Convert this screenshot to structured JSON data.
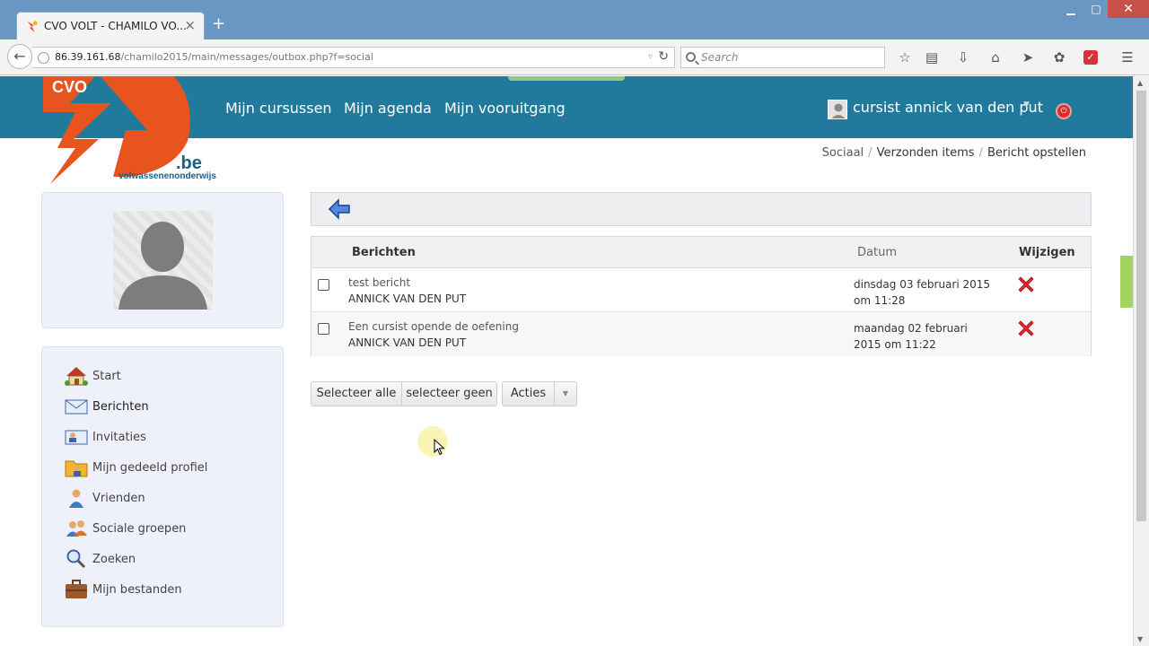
{
  "browser": {
    "tab_title": "CVO VOLT - CHAMILO VO...",
    "tab_close": "×",
    "new_tab": "+",
    "window_minimize": "▁",
    "window_maximize": "□",
    "window_close": "✕",
    "url_host": "86.39.161.68",
    "url_path": "/chamilo2015/main/messages/outbox.php?f=social",
    "search_placeholder": "Search",
    "toolbar_icons": [
      "bookmark-star-icon",
      "reading-list-icon",
      "download-icon",
      "home-icon",
      "send-icon",
      "pocket-icon",
      "addon-icon",
      "menu-icon"
    ]
  },
  "site": {
    "logo_word": "CVO",
    "logo_domain": ".be",
    "logo_tagline": "volwassenenonderwijs",
    "nav": [
      "Mijn cursussen",
      "Mijn agenda",
      "Mijn vooruitgang"
    ],
    "user_name": "cursist annick van den put",
    "header_color": "#217a9c",
    "accent_color": "#e8541e"
  },
  "breadcrumb": [
    "Sociaal",
    "Verzonden items",
    "Bericht opstellen"
  ],
  "sidebar": {
    "items": [
      {
        "label": "Start",
        "icon": "home-icon"
      },
      {
        "label": "Berichten",
        "icon": "envelope-icon"
      },
      {
        "label": "Invitaties",
        "icon": "invitation-icon"
      },
      {
        "label": "Mijn gedeeld profiel",
        "icon": "shared-profile-icon"
      },
      {
        "label": "Vrienden",
        "icon": "friend-icon"
      },
      {
        "label": "Sociale groepen",
        "icon": "groups-icon"
      },
      {
        "label": "Zoeken",
        "icon": "magnifier-icon"
      },
      {
        "label": "Mijn bestanden",
        "icon": "briefcase-icon"
      }
    ]
  },
  "messages": {
    "headers": {
      "message": "Berichten",
      "date": "Datum",
      "edit": "Wijzigen"
    },
    "rows": [
      {
        "title": "test bericht",
        "sender": "ANNICK VAN DEN PUT",
        "date": "dinsdag 03 februari 2015 om 11:28"
      },
      {
        "title": "Een cursist opende de oefening",
        "sender": "ANNICK VAN DEN PUT",
        "date": "maandag 02 februari 2015 om 11:22"
      }
    ]
  },
  "actions": {
    "select_all": "Selecteer alle",
    "select_none": "selecteer geen",
    "actions": "Acties"
  }
}
